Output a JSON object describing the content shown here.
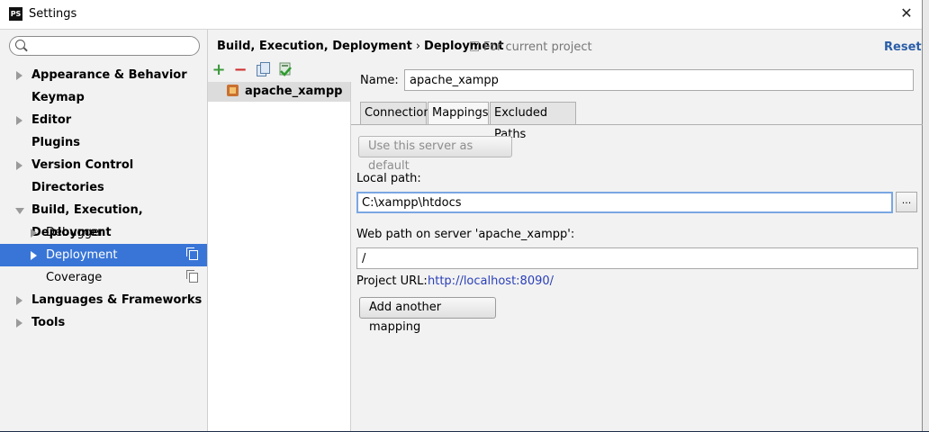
{
  "window": {
    "title": "Settings",
    "close_glyph": "✕"
  },
  "search": {
    "value": "",
    "placeholder": ""
  },
  "sidebar": {
    "items": [
      {
        "label": "Appearance & Behavior"
      },
      {
        "label": "Keymap"
      },
      {
        "label": "Editor"
      },
      {
        "label": "Plugins"
      },
      {
        "label": "Version Control"
      },
      {
        "label": "Directories"
      },
      {
        "label": "Build, Execution, Deployment"
      },
      {
        "label": "Debugger"
      },
      {
        "label": "Deployment"
      },
      {
        "label": "Coverage"
      },
      {
        "label": "Languages & Frameworks"
      },
      {
        "label": "Tools"
      }
    ],
    "selected": "Deployment"
  },
  "header": {
    "breadcrumb_parent": "Build, Execution, Deployment",
    "breadcrumb_sep": "›",
    "breadcrumb_current": "Deployment",
    "for_project": "For current project",
    "reset": "Reset"
  },
  "toolbar": {
    "add": "+",
    "remove": "−"
  },
  "servers": [
    {
      "label": "apache_xampp"
    }
  ],
  "form": {
    "name_label": "Name:",
    "name_value": "apache_xampp",
    "tabs": [
      {
        "label": "Connection"
      },
      {
        "label": "Mappings"
      },
      {
        "label": "Excluded Paths"
      }
    ],
    "active_tab": "Mappings",
    "use_default_label": "Use this server as default",
    "local_path_label": "Local path:",
    "local_path_value": "C:\\xampp\\htdocs",
    "browse_label": "...",
    "web_path_label": "Web path on server 'apache_xampp':",
    "web_path_value": "/",
    "project_url_label": "Project URL:",
    "project_url_value": "http://localhost:8090/",
    "add_mapping_label": "Add another mapping"
  },
  "colors": {
    "selection": "#3875d7",
    "link": "#2a3fb8",
    "reset": "#2a5ea8"
  }
}
